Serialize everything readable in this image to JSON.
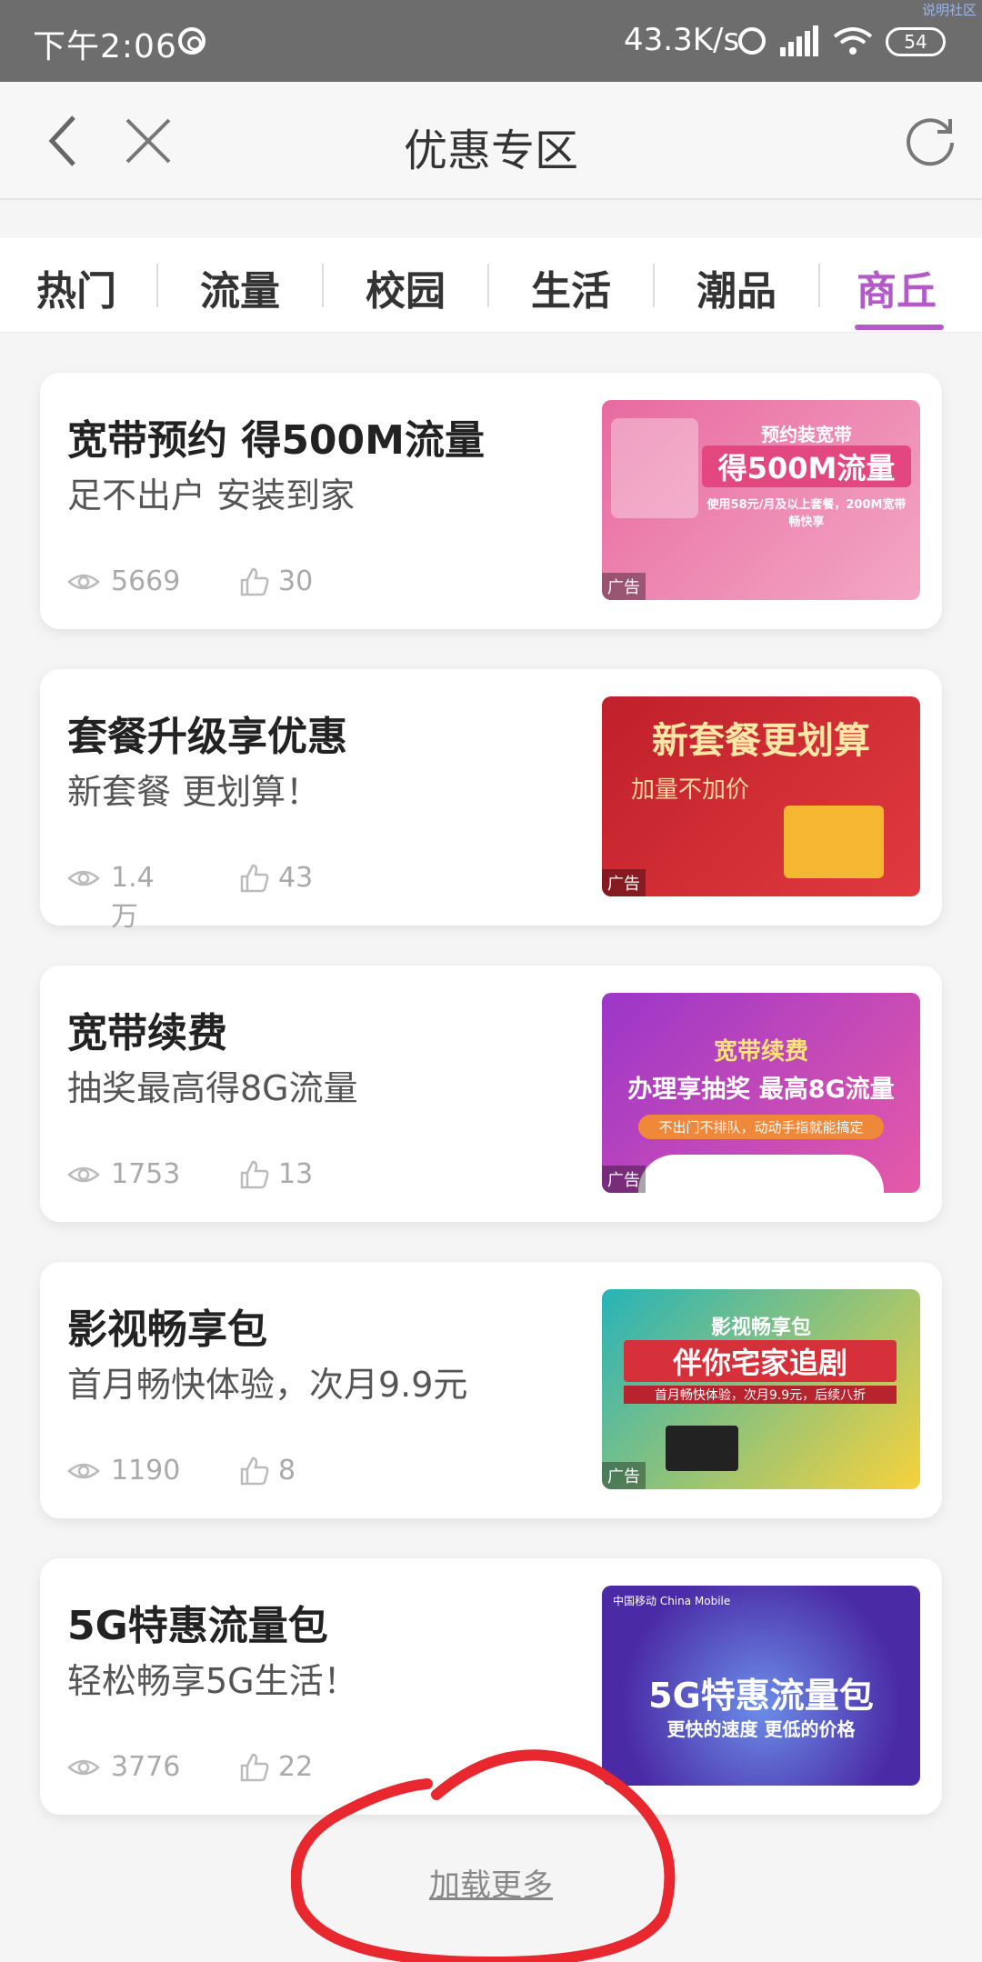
{
  "status": {
    "time": "下午2:06",
    "speed": "43.3K/s",
    "battery": "54",
    "corner": "说明社区"
  },
  "nav": {
    "title": "优惠专区"
  },
  "tabs": [
    "热门",
    "流量",
    "校园",
    "生活",
    "潮品",
    "商丘"
  ],
  "active_tab": "商丘",
  "cards": [
    {
      "title": "宽带预约 得500M流量",
      "subtitle": "足不出户 安装到家",
      "views": "5669",
      "likes": "30",
      "banner": {
        "bg": "linear-gradient(135deg,#e86aa0,#f3a7c4)",
        "lines": [
          "预约装宽带",
          "得500M流量",
          "使用58元/月及以上套餐，200M宽带畅快享"
        ],
        "ad": "广告"
      }
    },
    {
      "title": "套餐升级享优惠",
      "subtitle": "新套餐 更划算！",
      "views": "1.4万",
      "likes": "43",
      "banner": {
        "bg": "linear-gradient(135deg,#c0202b,#e03a3f)",
        "lines": [
          "新套餐更划算",
          "加量不加价"
        ],
        "ad": "广告"
      }
    },
    {
      "title": "宽带续费",
      "subtitle": "抽奖最高得8G流量",
      "views": "1753",
      "likes": "13",
      "banner": {
        "bg": "linear-gradient(135deg,#9b36c9,#e65aa8)",
        "lines": [
          "宽带续费",
          "办理享抽奖 最高8G流量",
          "不出门不排队，动动手指就能搞定"
        ],
        "ad": "广告"
      }
    },
    {
      "title": "影视畅享包",
      "subtitle": "首月畅快体验，次月9.9元",
      "views": "1190",
      "likes": "8",
      "banner": {
        "bg": "linear-gradient(135deg,#27b3b9,#f7d23c)",
        "lines": [
          "影视畅享包",
          "伴你宅家追剧",
          "首月畅快体验，次月9.9元，后续八折"
        ],
        "ad": "广告"
      }
    },
    {
      "title": "5G特惠流量包",
      "subtitle": "轻松畅享5G生活！",
      "views": "3776",
      "likes": "22",
      "banner": {
        "bg": "radial-gradient(circle at 50% 60%,#6b8ee8,#4b2aa6 70%)",
        "lines": [
          "中国移动 China Mobile",
          "5G特惠流量包",
          "更快的速度 更低的价格"
        ],
        "ad": ""
      }
    }
  ],
  "footer": {
    "load_more": "加载更多"
  },
  "colors": {
    "accent": "#b45ac8",
    "annotation": "#e8282e"
  }
}
